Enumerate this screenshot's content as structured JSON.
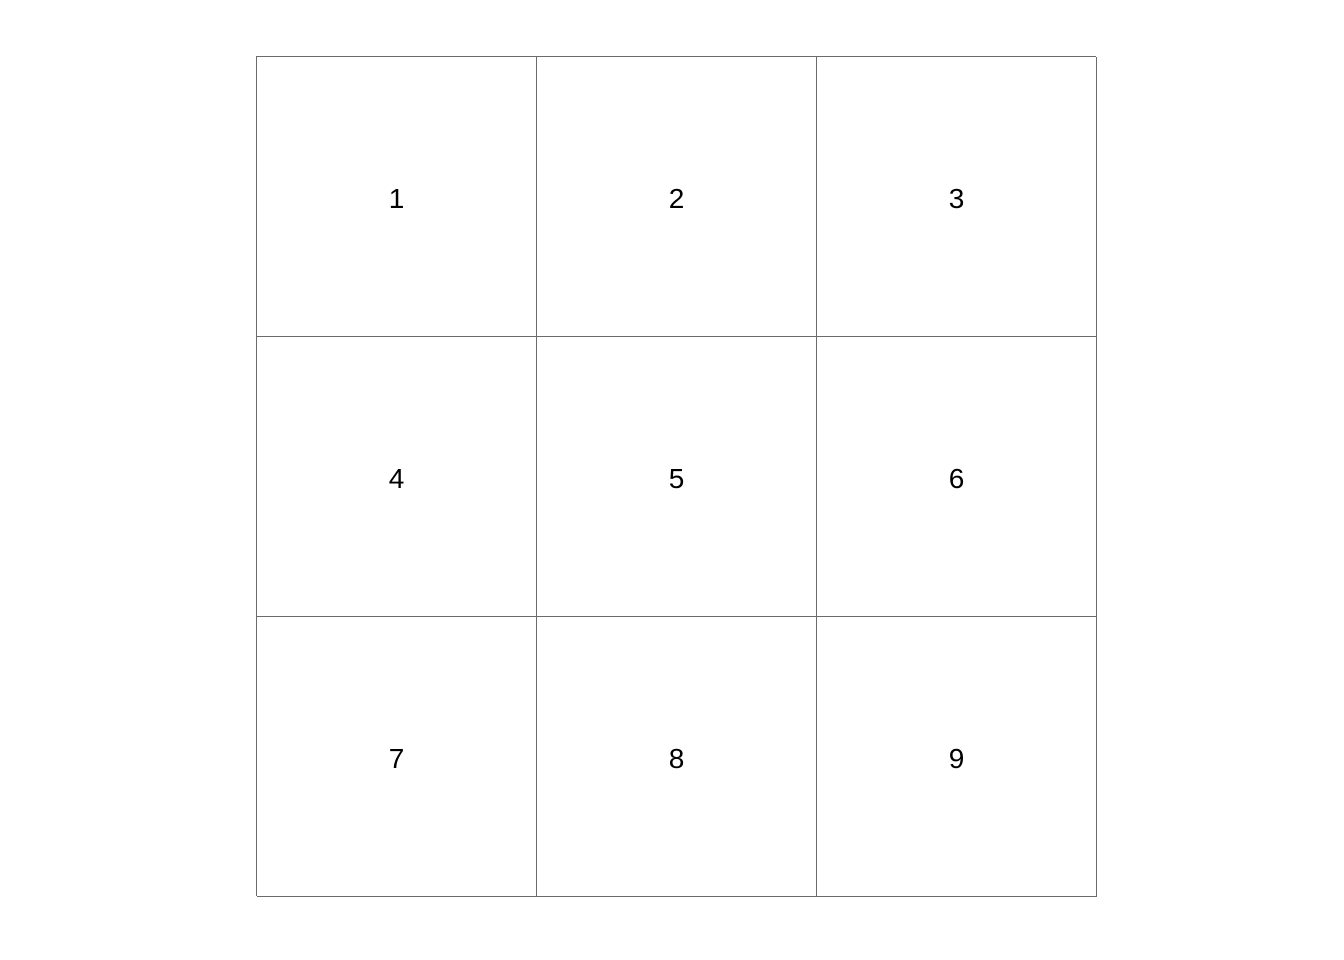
{
  "grid": {
    "rows": 3,
    "columns": 3,
    "line_color": "#6b6b6b",
    "cells": [
      "1",
      "2",
      "3",
      "4",
      "5",
      "6",
      "7",
      "8",
      "9"
    ]
  }
}
